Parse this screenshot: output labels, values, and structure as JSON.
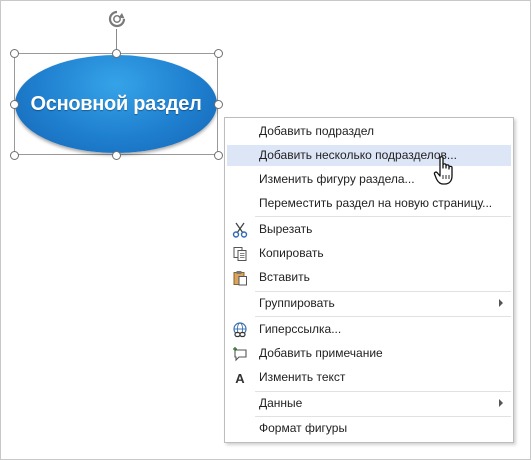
{
  "shape": {
    "label": "Основной раздел",
    "fill_color": "#1f7fcf"
  },
  "context_menu": {
    "items": [
      {
        "label": "Добавить подраздел",
        "icon": ""
      },
      {
        "label": "Добавить несколько подразделов...",
        "icon": "",
        "state": "hover"
      },
      {
        "label": "Изменить фигуру раздела...",
        "icon": ""
      },
      {
        "label": "Переместить раздел на новую страницу...",
        "icon": ""
      },
      {
        "label": "Вырезать",
        "icon": "scissors-icon"
      },
      {
        "label": "Копировать",
        "icon": "copy-icon"
      },
      {
        "label": "Вставить",
        "icon": "paste-icon"
      },
      {
        "label": "Группировать",
        "icon": "",
        "submenu": true
      },
      {
        "label": "Гиперссылка...",
        "icon": "hyperlink-icon"
      },
      {
        "label": "Добавить примечание",
        "icon": "comment-icon"
      },
      {
        "label": "Изменить текст",
        "icon": "text-icon"
      },
      {
        "label": "Данные",
        "icon": "",
        "submenu": true
      },
      {
        "label": "Формат фигуры",
        "icon": ""
      }
    ],
    "hover_color": "#dde6f7"
  },
  "cursor": "hand-pointer-icon"
}
